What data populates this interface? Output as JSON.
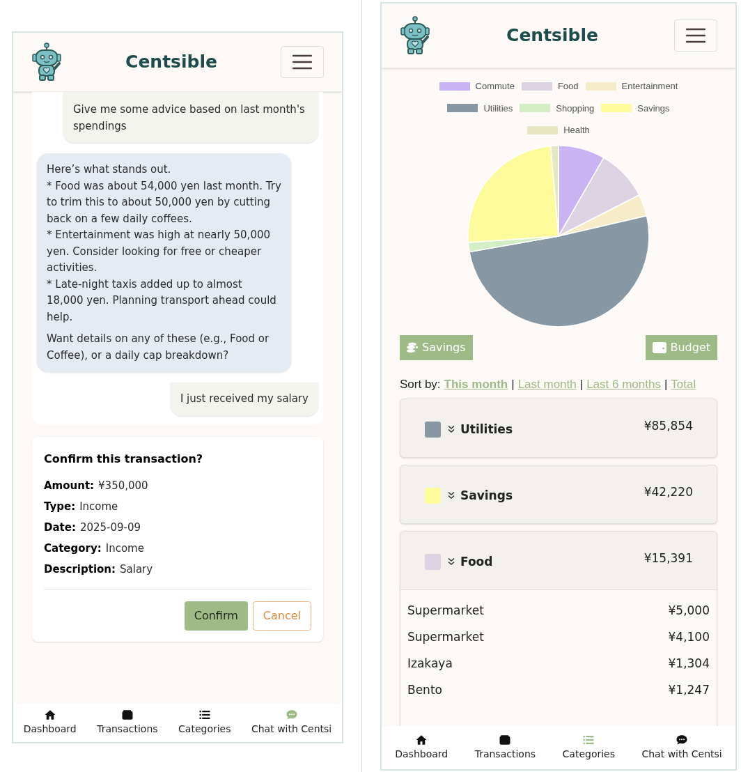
{
  "chat_screen": {
    "header": {
      "title": "Centsible"
    },
    "messages": [
      {
        "kind": "user",
        "paragraphs": [
          "Give me some advice based on last month's spendings"
        ]
      },
      {
        "kind": "bot",
        "paragraphs": [
          "Here’s what stands out.",
          "* Food was about 54,000 yen last month. Try to trim this to about 50,000 yen by cutting back on a few daily coffees.",
          "* Entertainment was high at nearly 50,000 yen. Consider looking for free or cheaper activities.",
          "* Late-night taxis added up to almost 18,000 yen. Planning transport ahead could help.",
          "Want details on any of these (e.g., Food or Coffee), or a daily cap breakdown?"
        ]
      },
      {
        "kind": "user",
        "paragraphs": [
          "I just received my salary"
        ]
      }
    ],
    "confirm": {
      "title": "Confirm this transaction?",
      "fields": [
        {
          "label": "Amount:",
          "value": "¥350,000"
        },
        {
          "label": "Type:",
          "value": "Income"
        },
        {
          "label": "Date:",
          "value": "2025-09-09"
        },
        {
          "label": "Category:",
          "value": "Income"
        },
        {
          "label": "Description:",
          "value": "Salary"
        }
      ],
      "confirm_button": "Confirm",
      "cancel_button": "Cancel"
    },
    "nav": [
      {
        "kind": "home",
        "label": "Dashboard",
        "selected": false
      },
      {
        "kind": "wallet",
        "label": "Transactions",
        "selected": false
      },
      {
        "kind": "list",
        "label": "Categories",
        "selected": false
      },
      {
        "kind": "chat",
        "label": "Chat with Centsi",
        "selected": true
      }
    ]
  },
  "categories_screen": {
    "header": {
      "title": "Centsible"
    },
    "legend": [
      {
        "label": "Commute",
        "color": "#c9b3f3"
      },
      {
        "label": "Food",
        "color": "#dad3e2"
      },
      {
        "label": "Entertainment",
        "color": "#f6ecc9"
      },
      {
        "label": "Utilities",
        "color": "#8797a3"
      },
      {
        "label": "Shopping",
        "color": "#d3edc4"
      },
      {
        "label": "Savings",
        "color": "#fdfa9c"
      },
      {
        "label": "Health",
        "color": "#e4e8c2"
      }
    ],
    "buttons": [
      {
        "kind": "coins",
        "label": "Savings"
      },
      {
        "kind": "wallet",
        "label": "Budget"
      }
    ],
    "sort": {
      "label": "Sort by:",
      "options": [
        {
          "label": "This month",
          "selected": true
        },
        {
          "separator": "|",
          "label": "Last month",
          "selected": false
        },
        {
          "separator": "|",
          "label": "Last 6 months",
          "selected": false
        },
        {
          "separator": "|",
          "label": "Total",
          "selected": false
        }
      ]
    },
    "categories": [
      {
        "name": "Utilities",
        "amount": "¥85,854",
        "color": "#8797a3",
        "expanded": false
      },
      {
        "name": "Savings",
        "amount": "¥42,220",
        "color": "#fdfa9c",
        "expanded": false
      },
      {
        "name": "Food",
        "amount": "¥15,391",
        "color": "#dad3e2",
        "expanded": true,
        "transactions": [
          {
            "name": "Supermarket",
            "amount": "¥5,000"
          },
          {
            "name": "Supermarket",
            "amount": "¥4,100"
          },
          {
            "name": "Izakaya",
            "amount": "¥1,304"
          },
          {
            "name": "Bento",
            "amount": "¥1,247"
          }
        ]
      }
    ],
    "nav": [
      {
        "kind": "home",
        "label": "Dashboard",
        "selected": false
      },
      {
        "kind": "wallet",
        "label": "Transactions",
        "selected": false
      },
      {
        "kind": "list",
        "label": "Categories",
        "selected": true
      },
      {
        "kind": "chat",
        "label": "Chat with Centsi",
        "selected": false
      }
    ]
  }
}
